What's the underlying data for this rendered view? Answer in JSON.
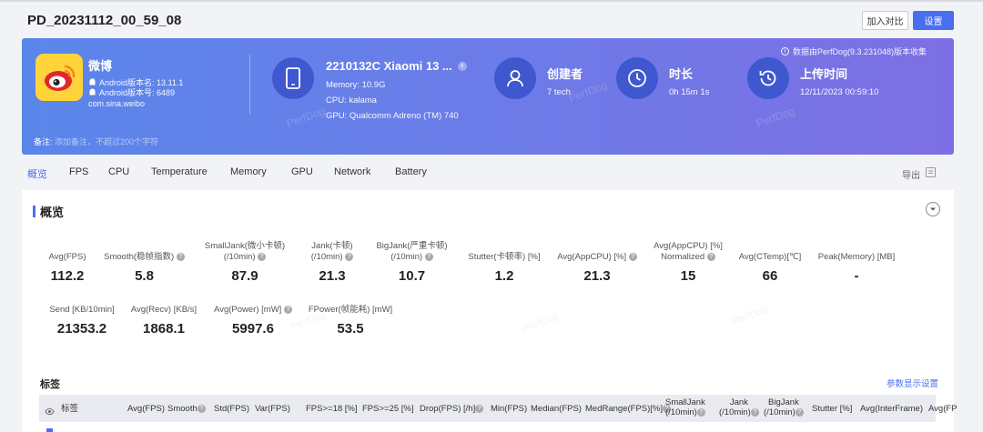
{
  "page_title": "PD_20231112_00_59_08",
  "actions": {
    "compare": "加入对比",
    "settings": "设置"
  },
  "banner": {
    "collect_note": "数据由PerfDog(9.3.231048)版本收集",
    "app": {
      "name": "微博",
      "android_version_name": "Android版本名: 13.11.1",
      "android_version_code": "Android版本号: 6489",
      "package": "com.sina.weibo"
    },
    "device": {
      "name": "2210132C Xiaomi 13 ...",
      "memory": "Memory: 10.9G",
      "cpu": "CPU: kalama",
      "gpu": "GPU: Qualcomm Adreno (TM) 740"
    },
    "creator": {
      "title": "创建者",
      "value": "7 tech"
    },
    "duration": {
      "title": "时长",
      "value": "0h 15m 1s"
    },
    "upload": {
      "title": "上传时间",
      "value": "12/11/2023 00:59:10"
    },
    "note_label": "备注:",
    "note_placeholder": "添加备注，不超过200个字符",
    "watermark": "PerfDog"
  },
  "tabs": [
    "概览",
    "FPS",
    "CPU",
    "Temperature",
    "Memory",
    "GPU",
    "Network",
    "Battery"
  ],
  "active_tab": 0,
  "export_label": "导出",
  "overview": {
    "title": "概览",
    "metrics_row1": [
      {
        "label": "Avg(FPS)",
        "value": "112.2"
      },
      {
        "label": "Smooth(稳帧指数)",
        "value": "5.8"
      },
      {
        "label": "SmallJank(微小卡顿)",
        "label2": "(/10min)",
        "value": "87.9"
      },
      {
        "label": "Jank(卡顿)",
        "label2": "(/10min)",
        "value": "21.3"
      },
      {
        "label": "BigJank(严重卡顿)",
        "label2": "(/10min)",
        "value": "10.7"
      },
      {
        "label": "Stutter(卡顿率) [%]",
        "value": "1.2"
      },
      {
        "label": "Avg(AppCPU) [%]",
        "value": "21.3"
      },
      {
        "label": "Avg(AppCPU) [%]",
        "label2": "Normalized",
        "value": "15"
      },
      {
        "label": "Avg(CTemp)[℃]",
        "value": "66"
      },
      {
        "label": "Peak(Memory) [MB]",
        "value": "-"
      }
    ],
    "metrics_row2": [
      {
        "label": "Send [KB/10min]",
        "value": "21353.2"
      },
      {
        "label": "Avg(Recv) [KB/s]",
        "value": "1868.1"
      },
      {
        "label": "Avg(Power) [mW]",
        "value": "5997.6"
      },
      {
        "label": "FPower(帧能耗) [mW]",
        "value": "53.5"
      }
    ]
  },
  "tags": {
    "title": "标签",
    "param_link": "参数显示设置",
    "columns": [
      {
        "l1": "标签"
      },
      {
        "l1": "Avg(FPS)"
      },
      {
        "l1": "Smooth"
      },
      {
        "l1": "Std(FPS)"
      },
      {
        "l1": "Var(FPS)"
      },
      {
        "l1": "FPS>=18 [%]"
      },
      {
        "l1": "FPS>=25 [%]"
      },
      {
        "l1": "Drop(FPS) [/h]"
      },
      {
        "l1": "Min(FPS)"
      },
      {
        "l1": "Median(FPS)"
      },
      {
        "l1": "MedRange(FPS)[%]"
      },
      {
        "l1": "SmallJank",
        "l2": "(/10min)"
      },
      {
        "l1": "Jank",
        "l2": "(/10min)"
      },
      {
        "l1": "BigJank",
        "l2": "(/10min)"
      },
      {
        "l1": "Stutter [%]"
      },
      {
        "l1": "Avg(InterFrame)"
      },
      {
        "l1": "Avg(FP"
      }
    ]
  }
}
